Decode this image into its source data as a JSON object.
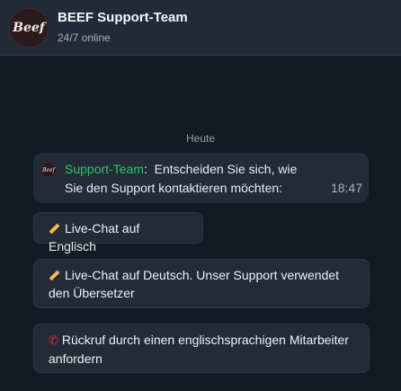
{
  "header": {
    "avatar_text": "Beef",
    "title": "BEEF Support-Team",
    "status": "24/7 online"
  },
  "chat": {
    "date_divider": "Heute",
    "message": {
      "avatar_text": "Beef",
      "sender": "Support-Team",
      "separator": ":",
      "line1": "Entscheiden Sie sich, wie",
      "line2": "Sie den Support kontaktieren möchten:",
      "time": "18:47"
    },
    "options": [
      {
        "icon": "pencil-icon",
        "label": "Live-Chat auf Englisch"
      },
      {
        "icon": "pencil-icon",
        "label": "Live-Chat auf Deutsch. Unser Support verwendet den Übersetzer"
      },
      {
        "icon": "phone-icon",
        "label": "Rückruf durch einen englischsprachigen Mitarbeiter anfordern"
      }
    ]
  },
  "colors": {
    "background": "#141a23",
    "header": "#222a36",
    "bubble": "#232b37",
    "sender": "#2ec56a",
    "phone": "#e0262f"
  }
}
